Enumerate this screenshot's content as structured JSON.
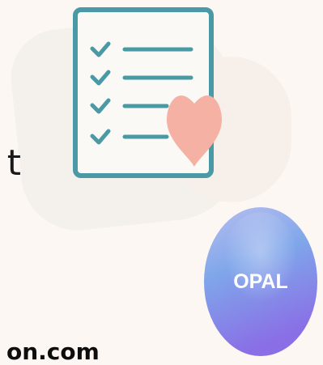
{
  "edge_text": "t",
  "logo": {
    "text": "OPAL",
    "colors": {
      "top": "#a9b6ef",
      "middle": "#7fa6ea",
      "bottom": "#8a6ee6",
      "text": "#ffffff"
    }
  },
  "illustration": {
    "icon": "checklist-with-heart",
    "check_count": 4,
    "colors": {
      "outline": "#4a9aa5",
      "heart": "#f4b1a4",
      "paper": "#fbf9f5"
    }
  },
  "bottom_text": "on.com"
}
